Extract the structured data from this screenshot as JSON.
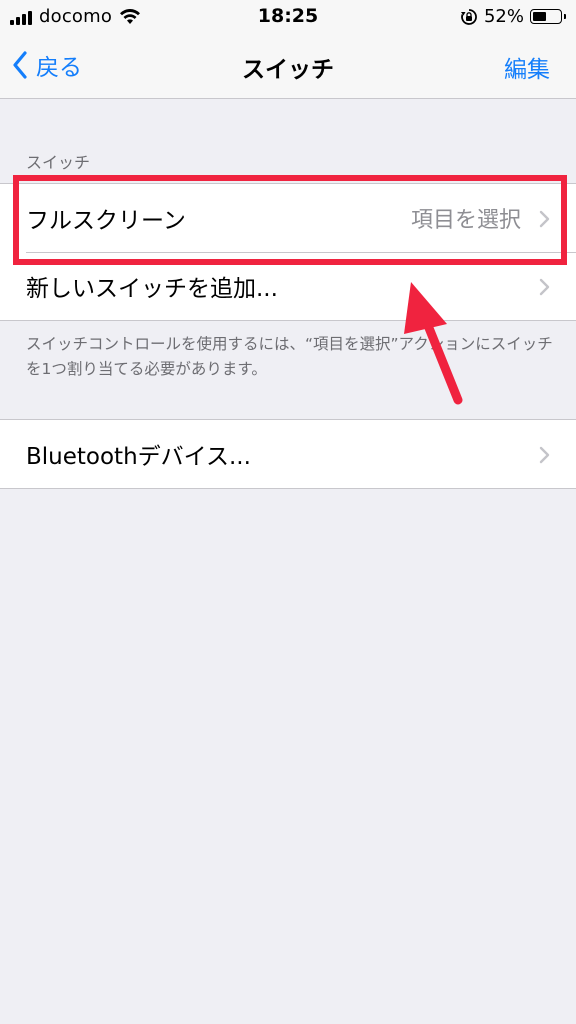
{
  "status_bar": {
    "carrier": "docomo",
    "time": "18:25",
    "battery_percent": "52%",
    "battery_level": 0.52
  },
  "nav": {
    "back_label": "戻る",
    "title": "スイッチ",
    "edit_label": "編集",
    "accent_color": "#147efb"
  },
  "switches_section": {
    "header": "スイッチ",
    "items": [
      {
        "label": "フルスクリーン",
        "detail": "項目を選択"
      },
      {
        "label": "新しいスイッチを追加..."
      }
    ],
    "footer": "スイッチコントロールを使用するには、“項目を選択”アクションにスイッチを1つ割り当てる必要があります。"
  },
  "bluetooth_section": {
    "items": [
      {
        "label": "Bluetoothデバイス..."
      }
    ]
  },
  "annotation": {
    "color": "#f0233f"
  }
}
